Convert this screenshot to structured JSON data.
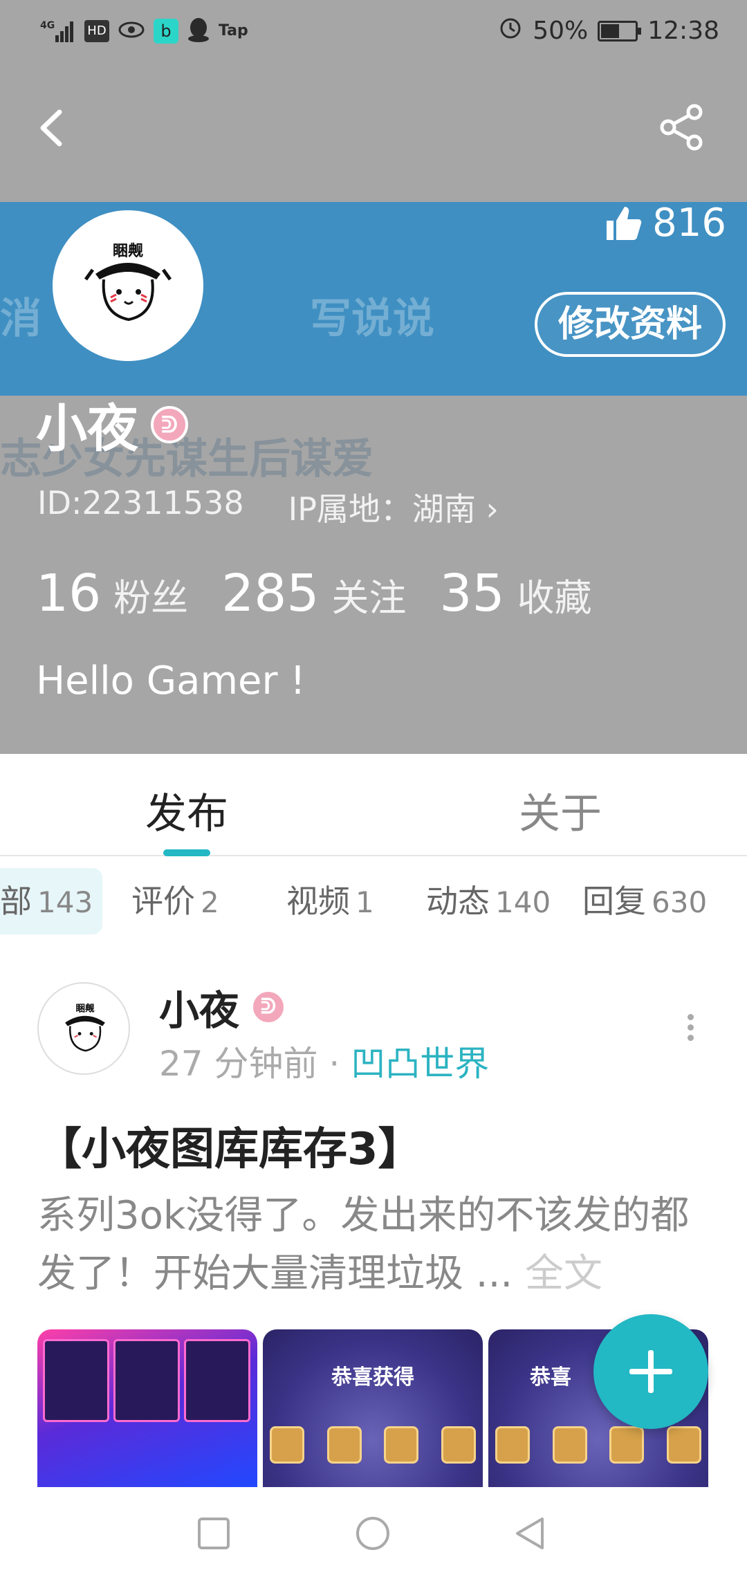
{
  "status_bar": {
    "signal_text": "4G",
    "hd_label": "HD",
    "b_label": "b",
    "tap_label": "Tap",
    "battery_percent": "50%",
    "time": "12:38"
  },
  "header": {
    "likes_count": "816",
    "edit_profile_label": "修改资料",
    "banner_ghost_left": "消",
    "banner_ghost_center": "写说说",
    "ghost_subtitle": "志少女先谋生后谋爱",
    "avatar_caption": "睏觍",
    "username": "小夜",
    "badge_glyph": "ᕲ",
    "id_text": "ID:22311538",
    "ip_text": "IP属地：湖南 ›",
    "stats": [
      {
        "num": "16",
        "label": "粉丝"
      },
      {
        "num": "285",
        "label": "关注"
      },
      {
        "num": "35",
        "label": "收藏"
      }
    ],
    "bio": "Hello Gamer !"
  },
  "tabs": [
    {
      "label": "发布"
    },
    {
      "label": "关于"
    }
  ],
  "filters": [
    {
      "label": "部",
      "count": "143"
    },
    {
      "label": "评价",
      "count": "2"
    },
    {
      "label": "视频",
      "count": "1"
    },
    {
      "label": "动态",
      "count": "140"
    },
    {
      "label": "回复",
      "count": "630"
    }
  ],
  "post": {
    "author": "小夜",
    "time_ago": "27 分钟前 · ",
    "source": "凹凸世界",
    "title": "【小夜图库库存3】",
    "body": "系列3ok没得了。发出来的不该发的都发了！开始大量清理垃圾 ... ",
    "full_text_link": "全文",
    "thumb_title": "恭喜获得",
    "thumb_title_partial": "恭喜"
  },
  "colors": {
    "accent": "#22b8c4",
    "header_bg": "#a6a6a6",
    "badge_pink": "#f3a7bb"
  }
}
